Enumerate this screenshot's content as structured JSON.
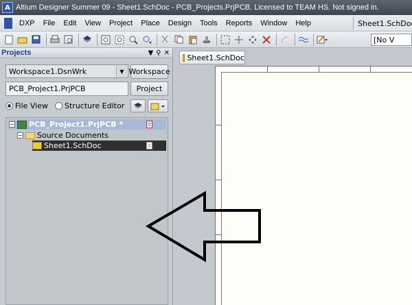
{
  "window": {
    "title": "Altium Designer Summer 09 - Sheet1.SchDoc - PCB_Projects.PrjPCB. Licensed to TEAM HS. Not signed in."
  },
  "menu": {
    "items": [
      "DXP",
      "File",
      "Edit",
      "View",
      "Project",
      "Place",
      "Design",
      "Tools",
      "Reports",
      "Window",
      "Help"
    ],
    "right_tab": "Sheet1.SchDoc"
  },
  "toolbar": {
    "combo_value": "[No V"
  },
  "projects_panel": {
    "title": "Projects",
    "workspace_value": "Workspace1.DsnWrk",
    "workspace_button": "Workspace",
    "project_value": "PCB_Project1.PrjPCB",
    "project_button": "Project",
    "view_file": "File View",
    "view_structure": "Structure Editor",
    "tree": {
      "project": "PCB_Project1.PrjPCB *",
      "source_folder": "Source Documents",
      "document": "Sheet1.SchDoc"
    }
  },
  "document": {
    "tab": "Sheet1.SchDoc"
  },
  "colors": {
    "titlebar": "#4a525c",
    "selection": "#2f2f2f",
    "project_highlight": "#a7b9d6",
    "sheet": "#fffdf7"
  }
}
